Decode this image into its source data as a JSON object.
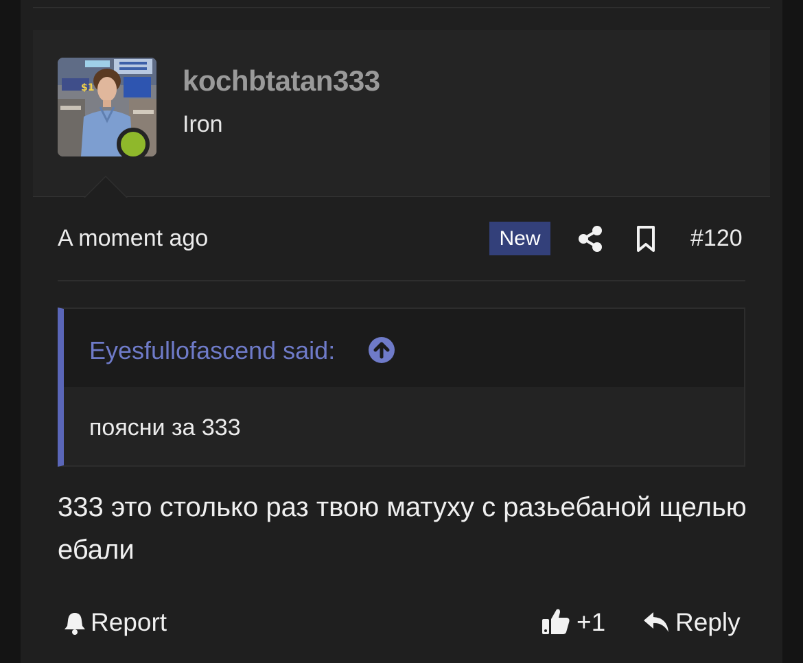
{
  "post": {
    "author": {
      "username": "kochbtatan333",
      "user_title": "Iron",
      "status_color": "#8fb82b"
    },
    "timestamp": "A moment ago",
    "badge": "New",
    "post_number": "#120",
    "quote": {
      "author_line": "Eyesfullofascend said:",
      "text": "поясни за 333"
    },
    "message": "333 это столько раз твою матуху с разьебаной щелью ебали",
    "actions": {
      "report_label": "Report",
      "like_count": "+1",
      "reply_label": "Reply"
    }
  },
  "icons": {
    "share": "share-icon",
    "bookmark": "bookmark-icon",
    "quote_jump": "arrow-up-circle-icon",
    "report": "bell-icon",
    "like": "thumbs-up-icon",
    "reply": "reply-icon"
  },
  "colors": {
    "accent": "#5a66b8",
    "badge_bg": "#33407a",
    "quote_text": "#6f7bc9"
  }
}
